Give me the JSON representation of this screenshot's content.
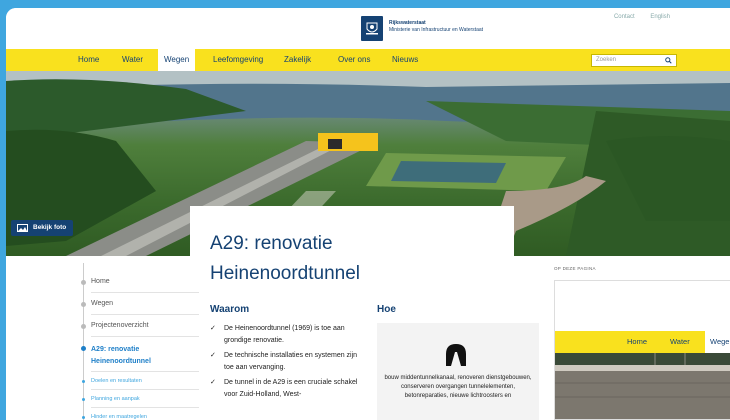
{
  "header": {
    "org_line1": "Rijkswaterstaat",
    "org_line2": "Ministerie van Infrastructuur en Waterstaat",
    "links": [
      "Contact",
      "English"
    ]
  },
  "nav": {
    "items": [
      "Home",
      "Water",
      "Wegen",
      "Leefomgeving",
      "Zakelijk",
      "Over ons",
      "Nieuws"
    ],
    "active": "Wegen",
    "search_placeholder": "Zoeken"
  },
  "hero": {
    "photo_button": "Bekijk foto"
  },
  "page": {
    "title": "A29: renovatie Heinenoordtunnel",
    "waarom": {
      "heading": "Waarom",
      "bullets": [
        "De Heinenoordtunnel (1969) is toe aan grondige renovatie.",
        "De technische installaties en systemen zijn toe aan vervanging.",
        "De tunnel in de A29 is een cruciale schakel voor Zuid-Holland, West-"
      ]
    },
    "hoe": {
      "heading": "Hoe",
      "text": "bouw middentunnelkanaal, renoveren dienstgebouwen, conserveren overgangen tunnelelementen, betonreparaties, nieuwe lichtroosters en"
    }
  },
  "sidebar": {
    "items": [
      {
        "label": "Home",
        "type": "main"
      },
      {
        "label": "Wegen",
        "type": "main"
      },
      {
        "label": "Projectenoverzicht",
        "type": "main"
      },
      {
        "label": "A29: renovatie Heinenoordtunnel",
        "type": "current"
      },
      {
        "label": "Doelen en resultaten",
        "type": "sub"
      },
      {
        "label": "Planning en aanpak",
        "type": "sub"
      },
      {
        "label": "Hinder en maatregelen",
        "type": "sub"
      }
    ]
  },
  "right_panel": {
    "label": "OP DEZE PAGINA",
    "nav_items": [
      "Home",
      "Water",
      "Wege"
    ]
  },
  "colors": {
    "background": "#3fa6df",
    "nav_yellow": "#f9e11e",
    "brand_blue": "#154273",
    "link_blue": "#1e7fc8"
  }
}
